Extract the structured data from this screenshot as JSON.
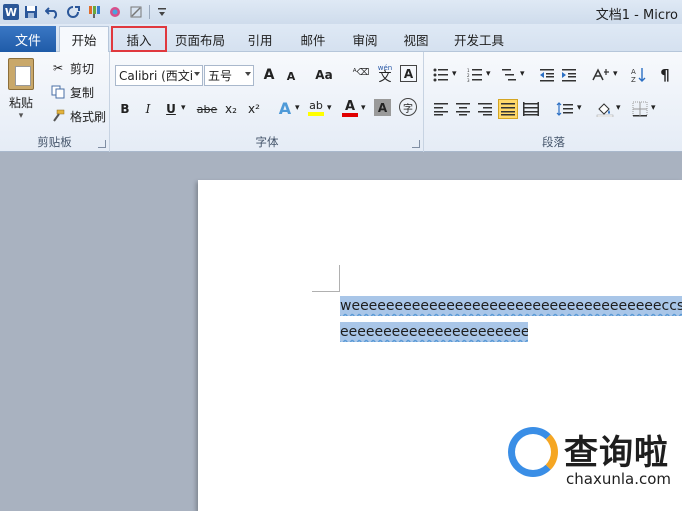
{
  "window": {
    "title": "文档1 - Micro"
  },
  "qat": {
    "word_logo": "W",
    "save_icon": "save-icon",
    "undo_icon": "undo-icon",
    "redo_icon": "redo-icon"
  },
  "tabs": {
    "file": "文件",
    "home": "开始",
    "insert": "插入",
    "page_layout": "页面布局",
    "references": "引用",
    "mailings": "邮件",
    "review": "审阅",
    "view": "视图",
    "developer": "开发工具"
  },
  "clipboard": {
    "label": "剪贴板",
    "paste": "粘贴",
    "cut": "剪切",
    "copy": "复制",
    "format_painter": "格式刷"
  },
  "font": {
    "label": "字体",
    "font_name": "Calibri (西文i",
    "font_size": "五号",
    "grow": "A",
    "shrink": "A",
    "change_case": "Aa",
    "bold": "B",
    "italic": "I",
    "underline": "U",
    "strike": "abe",
    "subscript": "x₂",
    "superscript": "x²",
    "highlight": "ab",
    "font_color": "A",
    "char_shading": "A",
    "enclose": "字",
    "wen": "wén",
    "wen_char": "文"
  },
  "paragraph": {
    "label": "段落"
  },
  "document": {
    "line1": "weeeeeeeeeeeeeeeeeeeeeeeeeeeeeeeeeeeeccssdcccc",
    "line2": "eeeeeeeeeeeeeeeeeeeeee",
    "para_mark": "↵"
  },
  "watermark": {
    "text": "查询啦",
    "url": "chaxunla.com"
  },
  "colors": {
    "file_tab": "#2b5fae",
    "highlight_border": "#e0383e",
    "selection": "#a9c6e8"
  }
}
